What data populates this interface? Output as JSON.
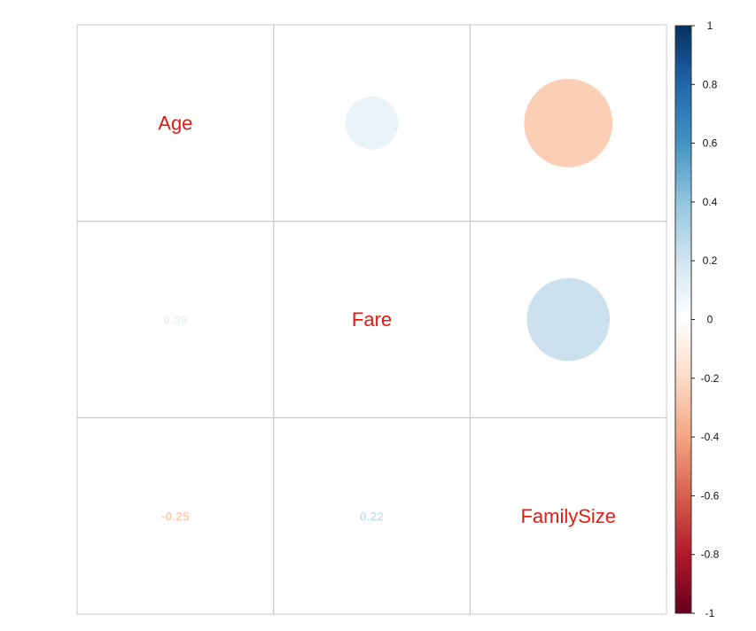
{
  "chart_data": {
    "type": "heatmap",
    "variables": [
      "Age",
      "Fare",
      "FamilySize"
    ],
    "correlation_matrix": [
      [
        1,
        0.09,
        -0.25
      ],
      [
        0.09,
        1,
        0.22
      ],
      [
        -0.25,
        0.22,
        1
      ]
    ],
    "upper_triangle_style": "circle",
    "lower_triangle_style": "number",
    "diagonal_style": "variable-name",
    "diagonal_label_color": "#e8190f",
    "colorbar": {
      "range": [
        -1,
        1
      ],
      "ticks": [
        "1",
        "0.8",
        "0.6",
        "0.4",
        "0.2",
        "0",
        "-0.2",
        "-0.4",
        "-0.6",
        "-0.8",
        "-1"
      ],
      "position": "right",
      "colors": [
        "#67001f",
        "#b2182b",
        "#d6604d",
        "#f4a582",
        "#fddbc7",
        "#ffffff",
        "#d1e5f0",
        "#92c5de",
        "#4393c3",
        "#2166ac",
        "#053061"
      ]
    },
    "grid": true,
    "title": "",
    "xlabel": "",
    "ylabel": ""
  }
}
